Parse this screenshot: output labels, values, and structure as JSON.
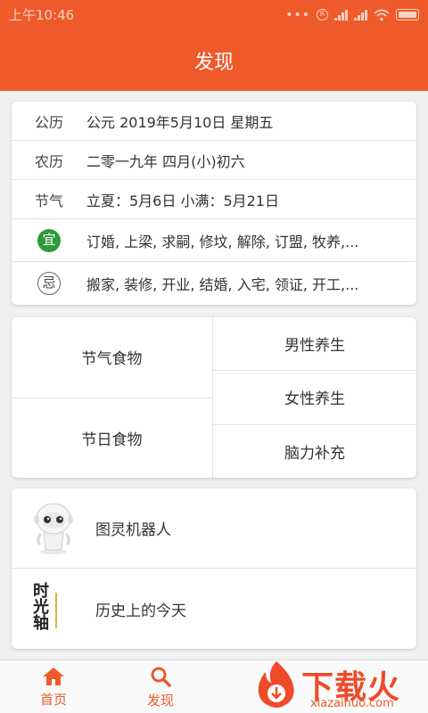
{
  "status_bar": {
    "time": "上午10:46"
  },
  "header": {
    "title": "发现"
  },
  "calendar": {
    "gregorian": {
      "label": "公历",
      "value": "公元 2019年5月10日 星期五"
    },
    "lunar": {
      "label": "农历",
      "value": "二零一九年 四月(小)初六"
    },
    "solar_term": {
      "label": "节气",
      "value": "立夏：5月6日 小满：5月21日"
    },
    "suitable": {
      "badge": "宜",
      "value": "订婚, 上梁, 求嗣, 修坟, 解除, 订盟, 牧养,..."
    },
    "avoid": {
      "badge": "忌",
      "value": "搬家, 装修, 开业, 结婚, 入宅, 领证, 开工,..."
    }
  },
  "food": {
    "solar_term_food": "节气食物",
    "holiday_food": "节日食物",
    "male_health": "男性养生",
    "female_health": "女性养生",
    "brain_supplement": "脑力补充"
  },
  "tools": {
    "turing_robot": "图灵机器人",
    "today_in_history": "历史上的今天",
    "history_icon_text": "时光轴"
  },
  "bottom_nav": {
    "home": "首页",
    "discover": "发现"
  },
  "watermark": {
    "text": "下载火",
    "domain": "xiazaihuo.com"
  },
  "colors": {
    "primary": "#ee5a2a",
    "suitable_green": "#2e9a3c"
  },
  "icons": {
    "home": "home-icon",
    "discover": "search-icon",
    "robot": "robot-icon",
    "history": "timeline-icon"
  }
}
